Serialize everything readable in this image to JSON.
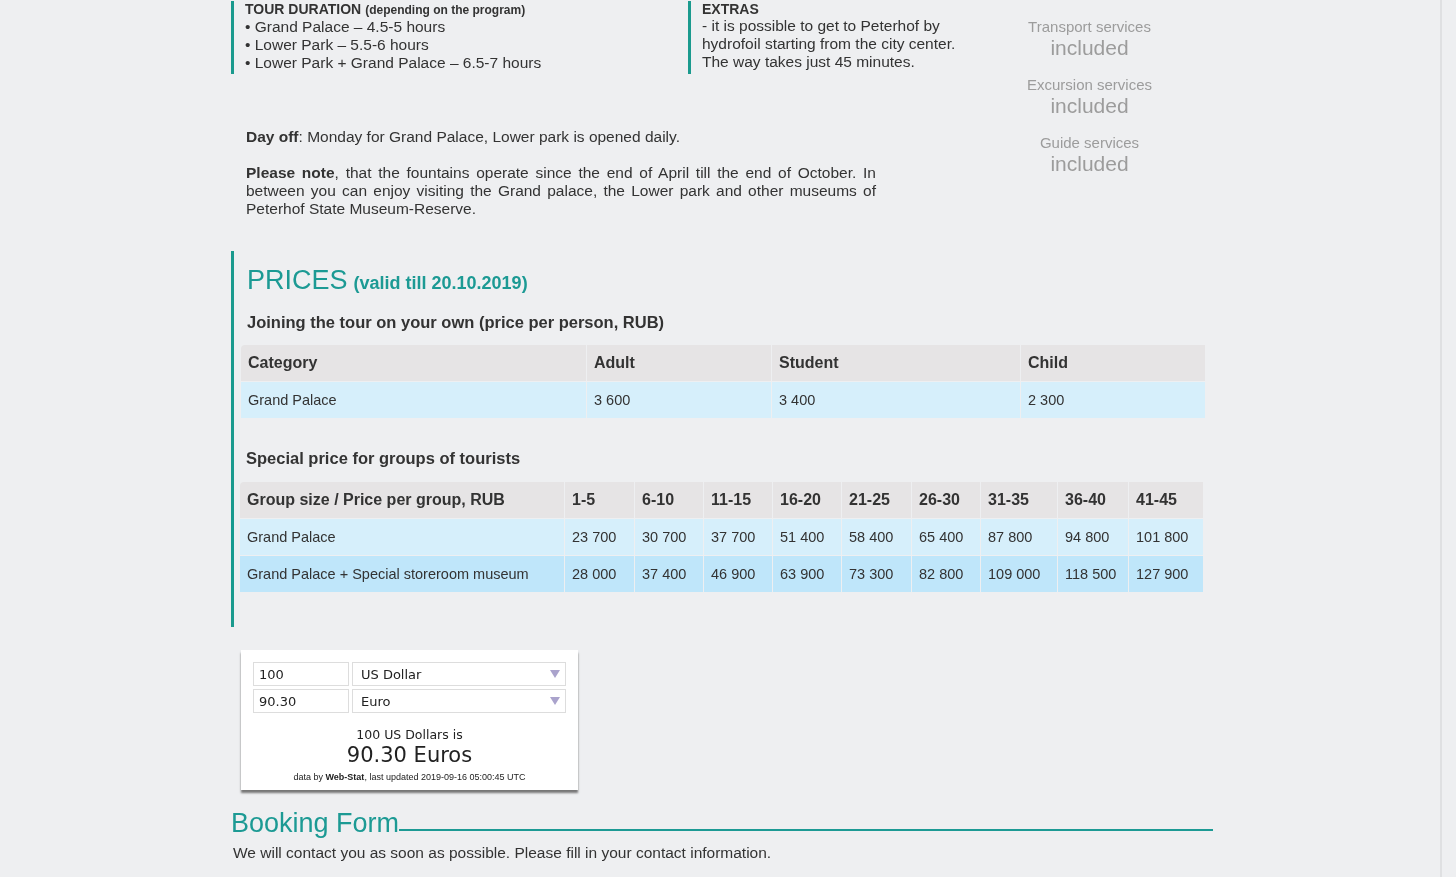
{
  "tour_duration": {
    "heading": "TOUR DURATION",
    "heading_note": "(depending on the program)",
    "items": [
      "• Grand Palace – 4.5-5 hours",
      "• Lower Park – 5.5-6 hours",
      "• Lower Park + Grand Palace –  6.5-7 hours"
    ]
  },
  "extras": {
    "heading": "EXTRAS",
    "lines": [
      "- it is possible to get to Peterhof by",
      "hydrofoil starting from the city center.",
      "The way takes just 45 minutes."
    ]
  },
  "services": [
    {
      "label": "Transport services",
      "value": "included"
    },
    {
      "label": "Excursion services",
      "value": "included"
    },
    {
      "label": "Guide services",
      "value": "included"
    }
  ],
  "notes": [
    {
      "text": "**Day off**: Monday for Grand Palace, Lower park is opened daily."
    },
    {
      "text": "**Please note**, that the fountains operate since the end of April till the end of October. In between you can enjoy visiting the Grand palace, the Lower park and other museums of Peterhof State Museum-Reserve."
    }
  ],
  "prices": {
    "title": "PRICES",
    "validity": "(valid till 20.10.2019)",
    "tables": [
      {
        "heading": "Joining the tour on your own (price per person, RUB)",
        "columns": [
          "Category",
          "Adult",
          "Student",
          "Child"
        ],
        "rows": [
          [
            "Grand Palace",
            "3 600",
            "3 400",
            "2 300"
          ]
        ]
      },
      {
        "heading": "Special price for groups of tourists",
        "columns": [
          "Group size / Price per group, RUB",
          "1-5",
          "6-10",
          "11-15",
          "16-20",
          "21-25",
          "26-30",
          "31-35",
          "36-40",
          "41-45"
        ],
        "rows": [
          [
            "Grand Palace",
            "23 700",
            "30 700",
            "37 700",
            "51 400",
            "58 400",
            "65 400",
            "87 800",
            "94 800",
            "101 800"
          ],
          [
            "Grand Palace + Special storeroom museum",
            "28 000",
            "37 400",
            "46 900",
            "63 900",
            "73 300",
            "82 800",
            "109 000",
            "118 500",
            "127 900"
          ]
        ]
      }
    ]
  },
  "converter": {
    "rows": [
      {
        "amount": "100",
        "currency": "US Dollar"
      },
      {
        "amount": "90.30",
        "currency": "Euro"
      }
    ],
    "summary": "100 US Dollars is",
    "result": "90.30 Euros",
    "credit": "data by **Web-Stat**, last updated 2019-09-16 05:00:45 UTC"
  },
  "booking": {
    "title": "Booking Form",
    "text": "We will contact you as soon as possible. Please fill in your contact information."
  }
}
